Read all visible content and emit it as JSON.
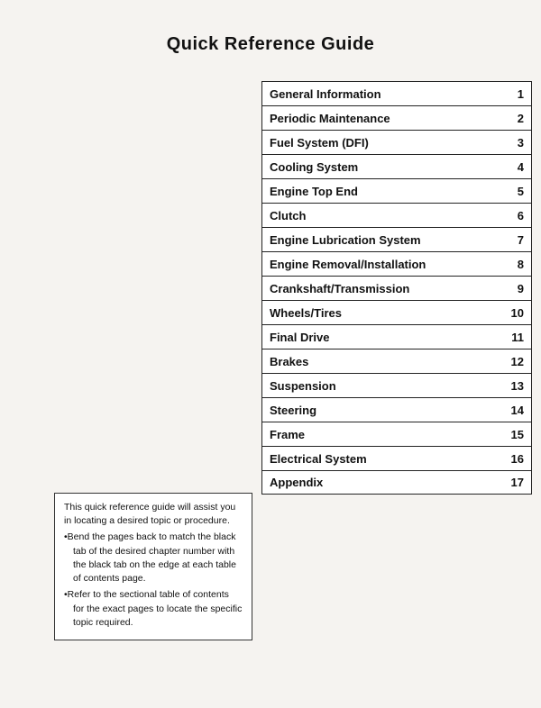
{
  "page": {
    "title": "Quick Reference Guide",
    "toc": [
      {
        "label": "General Information",
        "number": "1"
      },
      {
        "label": "Periodic Maintenance",
        "number": "2"
      },
      {
        "label": "Fuel System (DFI)",
        "number": "3"
      },
      {
        "label": "Cooling System",
        "number": "4"
      },
      {
        "label": "Engine Top End",
        "number": "5"
      },
      {
        "label": "Clutch",
        "number": "6"
      },
      {
        "label": "Engine Lubrication System",
        "number": "7"
      },
      {
        "label": "Engine Removal/Installation",
        "number": "8"
      },
      {
        "label": "Crankshaft/Transmission",
        "number": "9"
      },
      {
        "label": "Wheels/Tires",
        "number": "10"
      },
      {
        "label": "Final Drive",
        "number": "11"
      },
      {
        "label": "Brakes",
        "number": "12"
      },
      {
        "label": "Suspension",
        "number": "13"
      },
      {
        "label": "Steering",
        "number": "14"
      },
      {
        "label": "Frame",
        "number": "15"
      },
      {
        "label": "Electrical System",
        "number": "16"
      },
      {
        "label": "Appendix",
        "number": "17"
      }
    ],
    "note": {
      "intro": "This quick reference guide will assist you in locating a desired topic or procedure.",
      "bullet1": "Bend the pages back to match the black tab of the desired chapter number with the black tab on the edge at each table of contents page.",
      "bullet2": "Refer to the sectional table of contents for the exact pages to locate the specific topic required."
    }
  }
}
